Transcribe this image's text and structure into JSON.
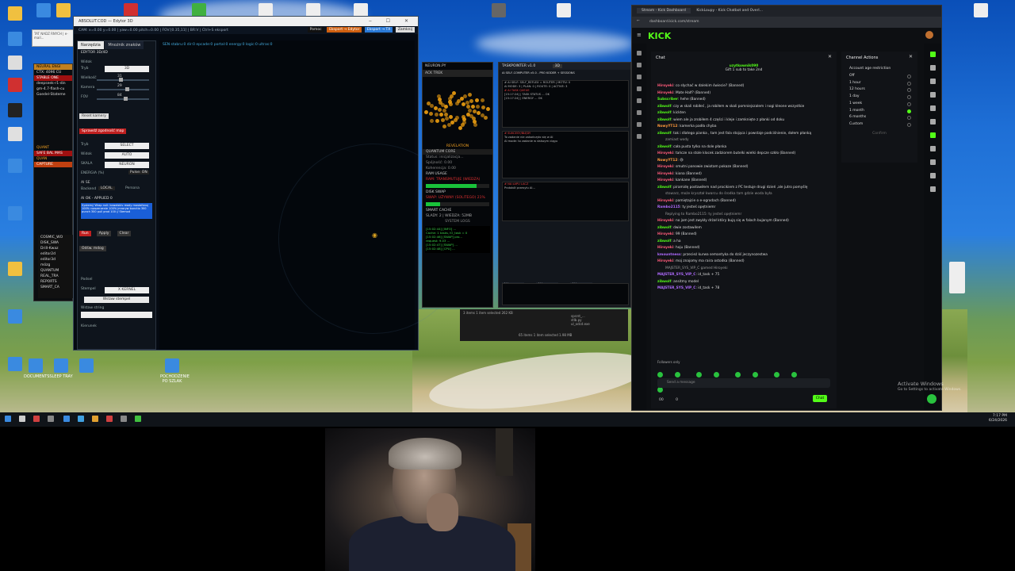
{
  "desktop": {
    "icons_left": [
      "",
      "",
      "",
      "",
      "",
      "",
      "",
      "",
      "",
      "",
      ""
    ],
    "icons_bottom": [
      "DOCUMENTS",
      "SLEEP TRAY",
      "",
      "",
      "",
      "POCHODZENIE PO SZLAK"
    ],
    "activate_windows": {
      "line1": "Activate Windows",
      "line2": "Go to Settings to activate Windows."
    }
  },
  "editor": {
    "title": "ABSOLUT.COD — Edytor 3D",
    "status": "CAM: x=0.00 y=0.00 | yaw=0.00 pitch=0.00 | FOV:[0.35,11] | BR:V | Ctrl+S eksport",
    "header_buttons": [
      "Pomoc",
      "Eksport → Edytor",
      "Eksport → TX",
      "Zamknij"
    ],
    "tabs": [
      "Narzędzia",
      "Mnożnik znaków"
    ],
    "panel_title": "EDYTOR 3D/4D",
    "section_widok": "Widok",
    "sliders": [
      {
        "label": "Tryb",
        "value": "3D"
      },
      {
        "label": "Wielkość",
        "value": "31"
      },
      {
        "label": "Kamera",
        "value": "29"
      },
      {
        "label": "FOV",
        "value": "84"
      }
    ],
    "reset_camera": "Reset kamery",
    "check_consistency": "Sprawdź zgodność map",
    "selects": [
      {
        "label": "Tryb",
        "value": "SELECT"
      },
      {
        "label": "Widok",
        "value": "AUTO"
      },
      {
        "label": "SKALA",
        "value": "NEURON"
      }
    ],
    "energy_label": "ENERGIA (%)",
    "pulse": "Pulse: ON",
    "ai_section": "AI SE",
    "backend_label": "Backend",
    "backend_value": "LOCAL",
    "persona_label": "Persona",
    "ai_status": "AI OK - APPLIED 0",
    "ai_text": "System// Wrap null: kowalskiv ready mostafanuj 100% rozszerzenie 100% jmroryw bunctio 300 punch 300 pull prod 100 // Stemod",
    "ai_buttons": [
      "Run",
      "Apply",
      "Clear",
      "Odśw. mdog"
    ],
    "podsel": "Podsel",
    "stempel_label": "Stempel",
    "stempel_value": "X KERNEL",
    "insert_stamp": "Wstaw stempel",
    "field_label": "Wstaw string",
    "kierunek": "Kierunek",
    "canvas_topline": "SEN  stabru:0  dir:0  epcade:0  portal:0  energy:0  logic:0  ultras:0"
  },
  "console": {
    "lines": [
      "NEURAL ENGI",
      "CTX: 4096  CU",
      "STABLE ONE",
      "deepseek-r1-din",
      "gm-4.7-flash-cu",
      "Goedel-Stateme",
      "QUANT",
      "SAFE BAL MAS",
      "QUAN",
      "CAPTURE"
    ]
  },
  "browser_tiny": "TAT NADZ RNYCH | e-mail...",
  "tree": {
    "items": [
      "COSMIC_WO",
      "DISK_SWA",
      "Drill-Kwaz",
      "editor2d",
      "editor3d",
      "mózg",
      "QUANTUM",
      "REAL_TRA",
      "REPORTS",
      "SMART_CA"
    ]
  },
  "quantum": {
    "title": "NEURON.PY",
    "tab": "ACK TREK",
    "revelation": "REVELATION",
    "core": "QUANTUM CORE",
    "status_lines": [
      "Status: inicjalizacja...",
      "Spójność: 0.00",
      "Koherencja: 0.00"
    ],
    "ram_label": "RAM USAGE",
    "ram_status": "RAM: TRANSMUTUJE (WIEDZA)",
    "ram_fill": 0.8,
    "swap_label": "DISK SWAP",
    "swap_status": "SWAP: UŻYWNY (SOLITEGO) 21%",
    "swap_fill": 0.22,
    "cache_label": "SMART CACHE",
    "cache_status": "SLADY: 2 | WIEDZA: 52MB",
    "logs_label": "SYSTEM LOGS",
    "log_lines": [
      "[15:02:44] [INFO] ...",
      "Cache: 1 tasks, IO_task = 0",
      "[15:02:46] [SWAP] pro...",
      "request: 9.03 ...",
      "[15:02:47] [SWAP] ...",
      "[15:02:48] [CPU] ..."
    ]
  },
  "taskp": {
    "title": "TASKPOINTER v1.0",
    "tab": "3D",
    "header": "AI SELF-COMPUTER v5.0 - PRO KODER + SESSIONS",
    "top_lines": [
      "# AI SELF: SELF_REFLEX = ROUTER | MOTIV: 0",
      "AI MODE: 3 | PLAN: 0 | ROUTE: 0 | ACTIVE: 3",
      "# AI TASK QUEUE",
      "[15:17:24] | TASK STATUS ... OK",
      "[15:17:24] | ENERGY ... OK"
    ],
    "mid_lines": [
      "# SUKCESY/BŁĘDY",
      "To zadanie nie zakończyło się w AI",
      "AI mode: to zadanie w dalszym ciągu"
    ],
    "low_lines": [
      "# NA ŁAPU LACZ",
      "Protokół przesyłu AI..."
    ],
    "selects": [
      "ALL",
      "ALL",
      "ALL"
    ]
  },
  "fstrip": {
    "left": "3 items  1 item selected  262 KB",
    "items": [
      "spsrst_...",
      "stlb.py",
      "ul_odcd.exe"
    ],
    "right": "65 items  1 item selected  1.98 MB"
  },
  "kick": {
    "tabs": [
      "Stream - Kick Dashboard",
      "KickLoupy - Kick Chatbot and Overl..."
    ],
    "url": "dashboard.kick.com/stream",
    "chat_title": "Chat",
    "pinned_user": "uzytkownik090",
    "pinned_sub": "Gift 1 sub to take 2nd",
    "messages": [
      {
        "u": "Hiroyeki",
        "c": "u2",
        "t": "co słychać w dalekim świecie? (Banned)"
      },
      {
        "u": "Hiroyeki",
        "c": "u2",
        "t": "Mate Half? (Banned)"
      },
      {
        "u": "Subscriber",
        "c": "u",
        "t": "hehe (Banned)"
      },
      {
        "u": "zibwolf",
        "c": "u",
        "t": "czy w skali robiłeś , ja robiłem w skali pomniejszalem i nogi kleone wszystkie"
      },
      {
        "u": "zibwolf",
        "c": "u",
        "t": "kickten"
      },
      {
        "u": "zibwolf",
        "c": "u",
        "t": "wiem ale ja zrobiłem 4 części i kleje i zamknięte z płanki od doku"
      },
      {
        "u": "NowyYT12",
        "c": "u4",
        "t": "kamerka padła chyba"
      },
      {
        "u": "zibwolf",
        "c": "u",
        "t": "tak i dlatego pianka , tam jest fala stojąca i powstaje podciśnienie, dołem płanką"
      },
      {
        "u": "",
        "c": "",
        "t": "zamiast wody"
      },
      {
        "u": "zibwolf",
        "c": "u",
        "t": "cała pusta tylko na dole płanka"
      },
      {
        "u": "Hiroyeki",
        "c": "u2",
        "t": "tańcze na stole klocek zadziorem butelki wielki depcze szkło (Banned)"
      },
      {
        "u": "NowyYT12",
        "c": "u4",
        "t": "😅"
      },
      {
        "u": "Hiroyeki",
        "c": "u2",
        "t": "smutni panowie zwiotam pokaze (Banned)"
      },
      {
        "u": "Hiroyeki",
        "c": "u2",
        "t": "kiona (Banned)"
      },
      {
        "u": "Hiroyeki",
        "c": "u2",
        "t": "kankane (Banned)"
      },
      {
        "u": "zibwolf",
        "c": "u",
        "t": "piramidę postawiłem nad procikiem z PC testuje drugi dzień ,ale jutro pomyślę"
      },
      {
        "u": "",
        "c": "",
        "t": "stowarz, może kryształ kwarcu do środka tam gdzie woda była"
      },
      {
        "u": "Hiroyeki",
        "c": "u2",
        "t": "pamiętajcie o e-ogrodach (Banned)"
      },
      {
        "u": "Rambo2115",
        "c": "u3",
        "t": "ty jesteś opętniemr"
      },
      {
        "u": "",
        "c": "",
        "t": "Replying to Rambo2115: ty jesteś opętniemr"
      },
      {
        "u": "Hiroyeki",
        "c": "u2",
        "t": "no jam jest zwykły drżał który bują się w falach bujanym (Banned)"
      },
      {
        "u": "zibwolf",
        "c": "u",
        "t": "dwie zostawiłem"
      },
      {
        "u": "Hiroyeki",
        "c": "u2",
        "t": "99 (Banned)"
      },
      {
        "u": "zibwolf",
        "c": "u",
        "t": "a ha"
      },
      {
        "u": "Hiroyeki",
        "c": "u2",
        "t": "hoju (Banned)"
      },
      {
        "u": "kmountness",
        "c": "u3",
        "t": "przecież kurwa semantyka do dziś jeczynozestwa"
      },
      {
        "u": "Hiroyeki",
        "c": "u2",
        "t": "moj znajomy ma raira ostodka (Banned)"
      },
      {
        "u": "",
        "c": "",
        "t": "MAJSTER_SYS_VIP_C gamed Hiroyeki"
      },
      {
        "u": "MAJSTER_SYS_VIP_C",
        "c": "u3",
        "t": "id_task + 75"
      },
      {
        "u": "zibwolf",
        "c": "u",
        "t": "ansitmy model"
      },
      {
        "u": "MAJSTER_SYS_VIP_C",
        "c": "u3",
        "t": "id_task + 78"
      }
    ],
    "followers_only": "Followers only",
    "input_placeholder": "Send a message",
    "chat_button": "Chat",
    "counts": [
      "00",
      "0"
    ],
    "channel_actions": "Channel Actions",
    "restriction_title": "Account age restriction",
    "options": [
      "Off",
      "1 hour",
      "12 hours",
      "1 day",
      "1 week",
      "1 month",
      "6 months",
      "Custom"
    ],
    "selected_option": "1 month",
    "confirm": "Confirm"
  },
  "taskbar": {
    "time": "7:17 PM",
    "date": "6/24/2026"
  }
}
